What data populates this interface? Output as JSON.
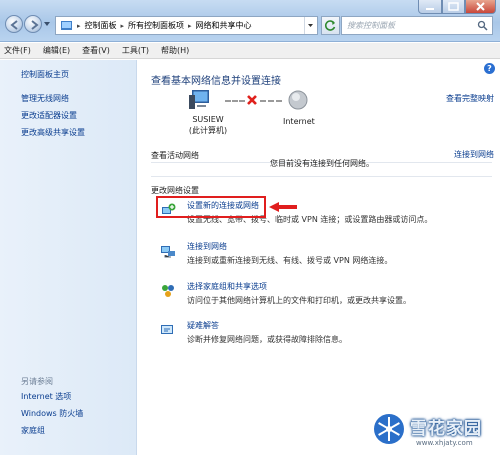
{
  "address_bar": {
    "crumbs": [
      "控制面板",
      "所有控制面板项",
      "网络和共享中心"
    ],
    "search_placeholder": "搜索控制面板"
  },
  "menu": [
    "文件(F)",
    "编辑(E)",
    "查看(V)",
    "工具(T)",
    "帮助(H)"
  ],
  "sidebar": {
    "home": "控制面板主页",
    "links": [
      "管理无线网络",
      "更改适配器设置",
      "更改高级共享设置"
    ],
    "see_also_title": "另请参阅",
    "see_also": [
      "Internet 选项",
      "Windows 防火墙",
      "家庭组"
    ]
  },
  "main": {
    "title": "查看基本网络信息并设置连接",
    "full_map": "查看完整映射",
    "computer_name": "SUSIEW",
    "computer_sub": "(此计算机)",
    "internet_label": "Internet",
    "active_title": "查看活动网络",
    "connect_link": "连接到网络",
    "not_connected": "您目前没有连接到任何网络。",
    "change_title": "更改网络设置",
    "tasks": [
      {
        "title": "设置新的连接或网络",
        "desc": "设置无线、宽带、拨号、临时或 VPN 连接；或设置路由器或访问点。",
        "icon": "new-connection-icon"
      },
      {
        "title": "连接到网络",
        "desc": "连接到或重新连接到无线、有线、拨号或 VPN 网络连接。",
        "icon": "connect-network-icon"
      },
      {
        "title": "选择家庭组和共享选项",
        "desc": "访问位于其他网络计算机上的文件和打印机，或更改共享设置。",
        "icon": "homegroup-icon"
      },
      {
        "title": "疑难解答",
        "desc": "诊断并修复网络问题，或获得故障排除信息。",
        "icon": "troubleshoot-icon"
      }
    ]
  },
  "watermark": {
    "title": "雪花家园",
    "url": "www.xhjaty.com"
  },
  "colors": {
    "link": "#0a3d8f",
    "highlight": "#e01e1e",
    "sidebar_bg": "#e3edf8"
  }
}
